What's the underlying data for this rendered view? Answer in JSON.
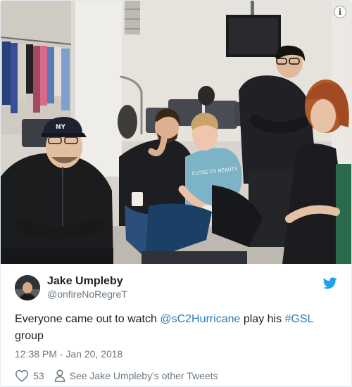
{
  "photo": {
    "alt": "",
    "cap_text": "NY",
    "shirt_text": "CLOSE TO\nBEAUTY"
  },
  "tweet": {
    "display_name": "Jake Umpleby",
    "screen_name": "@onfireNoRegreT",
    "text_before": "Everyone came out to watch ",
    "mention": "@sC2Hurricane",
    "text_middle": " play his ",
    "hashtag": "#GSL",
    "text_after": " group",
    "timestamp": "12:38 PM - Jan 20, 2018",
    "like_count": "53",
    "other_tweets_label": "See Jake Umpleby's other Tweets"
  },
  "icons": {
    "info": "info-icon",
    "twitter": "twitter-bird-icon",
    "heart": "heart-icon",
    "person": "person-icon"
  },
  "colors": {
    "link": "#2b7bb9",
    "twitter_blue": "#1da1f2",
    "muted": "#697882",
    "text": "#1c2022"
  }
}
